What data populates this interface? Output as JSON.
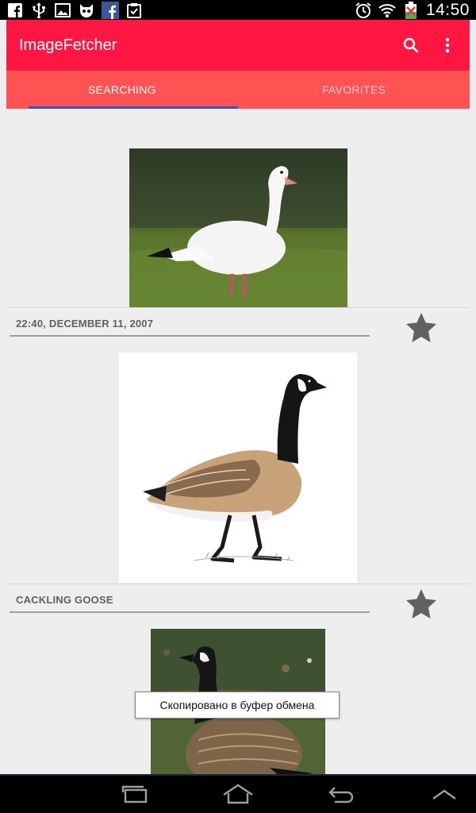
{
  "status_bar": {
    "time": "14:50",
    "left_icons": [
      "facebook-icon",
      "usb-icon",
      "gallery-icon",
      "cat-app-icon",
      "facebook-app-icon",
      "clipboard-check-icon"
    ],
    "right_icons": [
      "alarm-icon",
      "wifi-icon",
      "battery-charging-icon"
    ]
  },
  "toolbar": {
    "title": "ImageFetcher",
    "search_icon": "search-icon",
    "overflow_icon": "more-vert-icon",
    "color": "#ff1744"
  },
  "tabs": [
    {
      "label": "SEARCHING",
      "active": true
    },
    {
      "label": "FAVORITES",
      "active": false
    }
  ],
  "colors": {
    "tab_bar": "#ff5252",
    "tab_indicator": "#3f51b5",
    "star": "#616161"
  },
  "items": [
    {
      "caption": "22:40, December 11, 2007",
      "image": "white-goose-photo",
      "starred": false
    },
    {
      "caption": "Cackling Goose",
      "image": "canada-goose-illustration",
      "starred": false
    },
    {
      "caption": "",
      "image": "canada-goose-on-grass-photo",
      "starred": false
    }
  ],
  "toast": {
    "text": "Скопировано в буфер обмена"
  },
  "nav_bar": {
    "buttons": [
      "recent-apps-icon",
      "home-icon",
      "back-icon",
      "menu-up-icon"
    ]
  }
}
